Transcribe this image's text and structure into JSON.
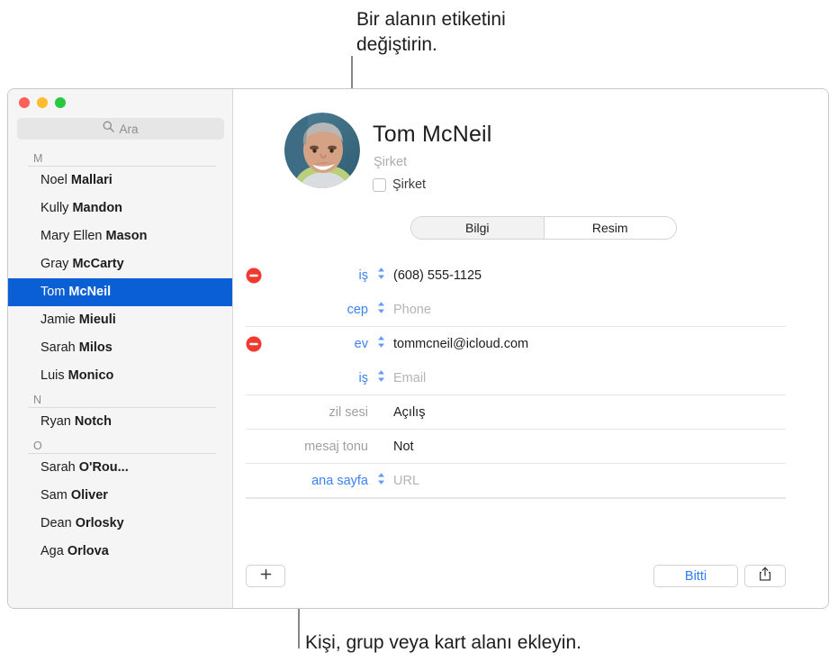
{
  "callouts": {
    "top": "Bir alanın etiketini\ndeğiştirin.",
    "bottom": "Kişi, grup veya kart alanı ekleyin."
  },
  "window": {
    "traffic_lights": {
      "close_color": "#ff5f57",
      "minimize_color": "#febc2e",
      "maximize_color": "#28c840"
    }
  },
  "sidebar": {
    "search": {
      "placeholder": "Ara",
      "icon": "search-icon"
    },
    "sections": [
      {
        "letter": "M",
        "contacts": [
          {
            "first": "Noel ",
            "last": "Mallari",
            "selected": false
          },
          {
            "first": "Kully ",
            "last": "Mandon",
            "selected": false
          },
          {
            "first": "Mary Ellen ",
            "last": "Mason",
            "selected": false
          },
          {
            "first": "Gray ",
            "last": "McCarty",
            "selected": false
          },
          {
            "first": "Tom ",
            "last": "McNeil",
            "selected": true
          },
          {
            "first": "Jamie ",
            "last": "Mieuli",
            "selected": false
          },
          {
            "first": "Sarah ",
            "last": "Milos",
            "selected": false
          },
          {
            "first": "Luis ",
            "last": "Monico",
            "selected": false
          }
        ]
      },
      {
        "letter": "N",
        "contacts": [
          {
            "first": "Ryan ",
            "last": "Notch",
            "selected": false
          }
        ]
      },
      {
        "letter": "O",
        "contacts": [
          {
            "first": "Sarah ",
            "last": "O'Rou...",
            "selected": false
          },
          {
            "first": "Sam ",
            "last": "Oliver",
            "selected": false
          },
          {
            "first": "Dean ",
            "last": "Orlosky",
            "selected": false
          },
          {
            "first": "Aga ",
            "last": "Orlova",
            "selected": false
          }
        ]
      }
    ],
    "selection_color": "#0b5fd4"
  },
  "detail": {
    "avatar": "contact-photo",
    "name": "Tom  McNeil",
    "company_placeholder": "Şirket",
    "company_checkbox_label": "Şirket",
    "company_checked": false,
    "tabs": [
      {
        "label": "Bilgi",
        "active": true
      },
      {
        "label": "Resim",
        "active": false
      }
    ],
    "fields": [
      {
        "removable": true,
        "label": "iş",
        "label_style": "blue",
        "has_stepper": true,
        "value": "(608) 555-1125",
        "is_placeholder": false,
        "separator": false
      },
      {
        "removable": false,
        "label": "cep",
        "label_style": "blue",
        "has_stepper": true,
        "value": "Phone",
        "is_placeholder": true,
        "separator": true
      },
      {
        "removable": true,
        "label": "ev",
        "label_style": "blue",
        "has_stepper": true,
        "value": "tommcneil@icloud.com",
        "is_placeholder": false,
        "separator": false
      },
      {
        "removable": false,
        "label": "iş",
        "label_style": "blue",
        "has_stepper": true,
        "value": "Email",
        "is_placeholder": true,
        "separator": true
      },
      {
        "removable": false,
        "label": "zil sesi",
        "label_style": "gray",
        "has_stepper": false,
        "value": "Açılış",
        "is_placeholder": false,
        "separator": true
      },
      {
        "removable": false,
        "label": "mesaj tonu",
        "label_style": "gray",
        "has_stepper": false,
        "value": "Not",
        "is_placeholder": false,
        "separator": true
      },
      {
        "removable": false,
        "label": "ana sayfa",
        "label_style": "blue",
        "has_stepper": true,
        "value": "URL",
        "is_placeholder": true,
        "separator": true
      }
    ],
    "bottom_bar": {
      "add_icon": "plus-icon",
      "done_label": "Bitti",
      "share_icon": "share-icon",
      "done_color": "#2f7cf6"
    }
  },
  "colors": {
    "accent_blue": "#3b82f6",
    "remove_red": "#f03a2f",
    "selection_blue": "#0b5fd4"
  }
}
